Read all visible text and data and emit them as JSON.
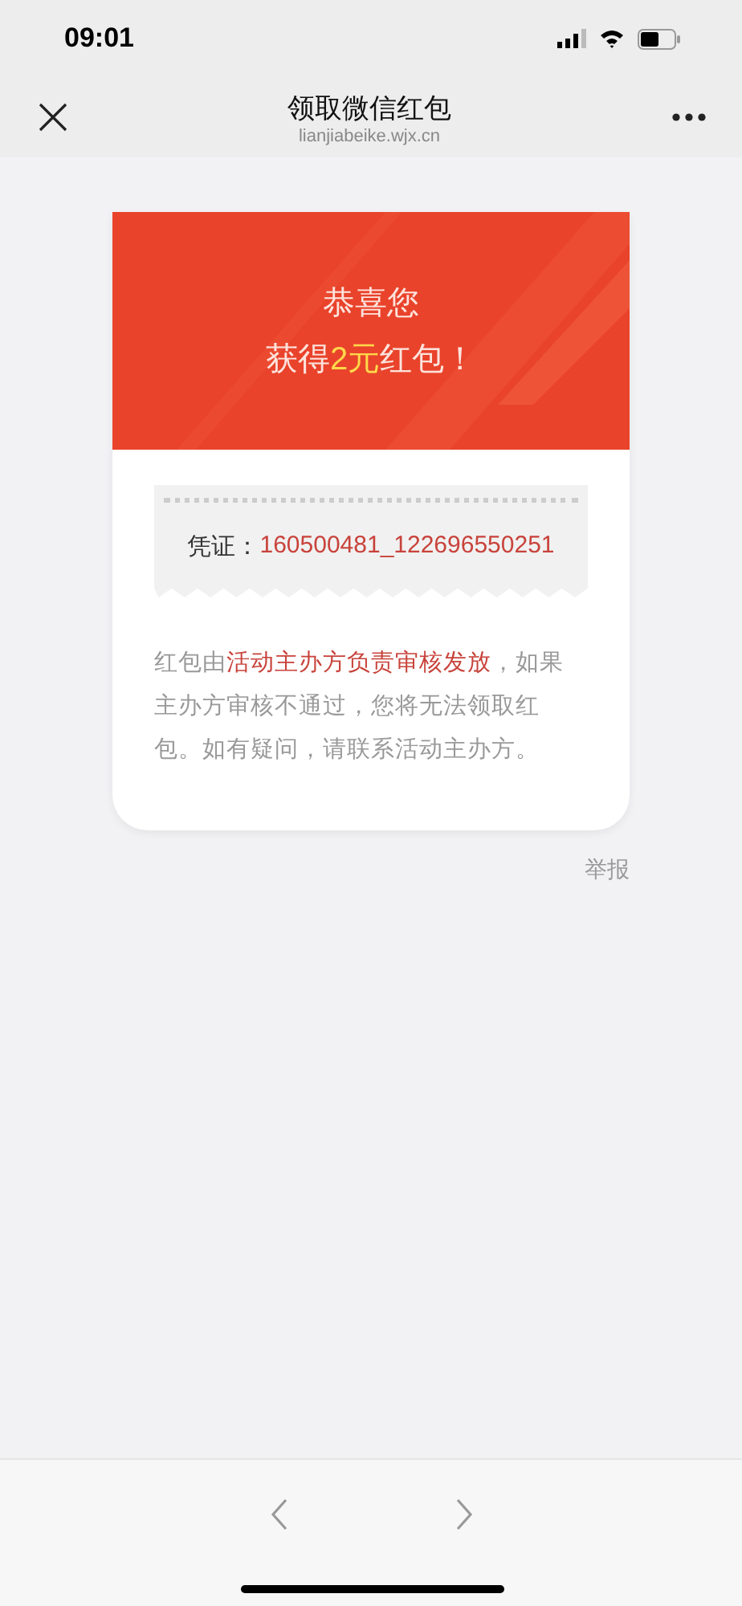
{
  "status_bar": {
    "time": "09:01"
  },
  "nav": {
    "title": "领取微信红包",
    "subtitle": "lianjiabeike.wjx.cn"
  },
  "card": {
    "greeting": "恭喜您",
    "prize": {
      "prefix": "获得",
      "amount": "2元",
      "suffix": "红包！"
    },
    "voucher": {
      "label": "凭证：",
      "value": "160500481_122696550251"
    },
    "notice": [
      {
        "text": "红包由",
        "highlight": false
      },
      {
        "text": "活动主办方负责审核发放",
        "highlight": true
      },
      {
        "text": "，如果主办方审核不通过，您将无法领取红包。如有疑问，请联系活动主办方。",
        "highlight": false
      }
    ]
  },
  "report_link": "举报"
}
